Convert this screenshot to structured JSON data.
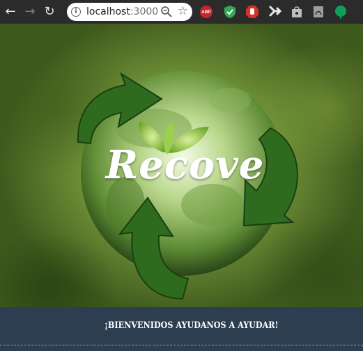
{
  "browser": {
    "back_icon": "←",
    "forward_icon": "→",
    "reload_icon": "↻",
    "url_host": "localhost",
    "url_port": ":3000",
    "star_icon": "☆",
    "extensions": {
      "abp_label": "ABP"
    }
  },
  "hero": {
    "brand": "Recove"
  },
  "bar": {
    "message": "¡BIENVENIDOS AYUDANOS A AYUDAR!"
  },
  "colors": {
    "footer_bg": "#2d3e50",
    "arrow_green": "#2f6b1e",
    "chrome_bg": "#2b2b2b"
  }
}
